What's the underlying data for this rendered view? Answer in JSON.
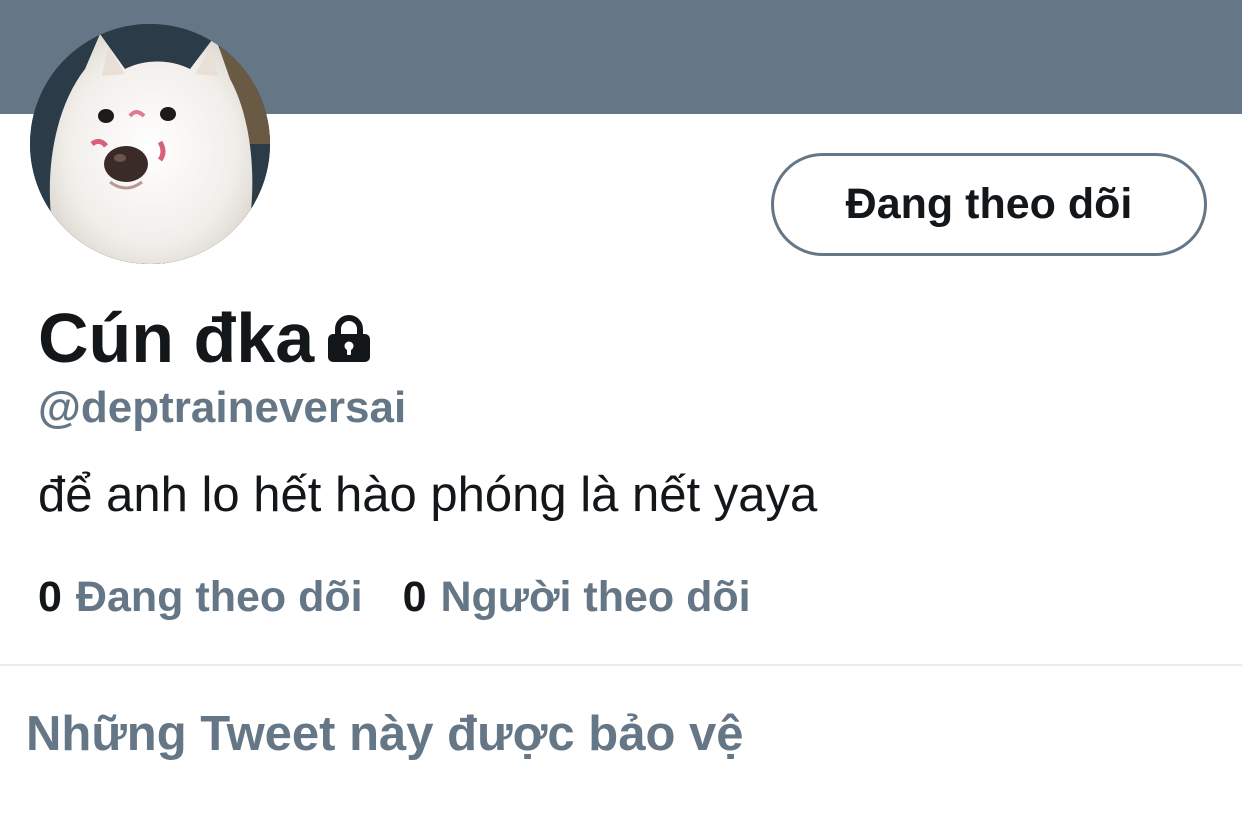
{
  "profile": {
    "display_name": "Cún đka",
    "handle": "@deptraineversai",
    "bio": "để anh lo hết hào phóng là nết yaya",
    "locked_icon": "lock-icon",
    "avatar_description": "white fluffy dog"
  },
  "actions": {
    "follow_button_label": "Đang theo dõi"
  },
  "stats": {
    "following_count": "0",
    "following_label": "Đang theo dõi",
    "followers_count": "0",
    "followers_label": "Người theo dõi"
  },
  "notice": {
    "protected_text": "Những Tweet này được bảo vệ"
  },
  "colors": {
    "banner": "#657786",
    "primary_text": "#14171a",
    "secondary_text": "#657786",
    "divider": "#e6ecf0"
  }
}
